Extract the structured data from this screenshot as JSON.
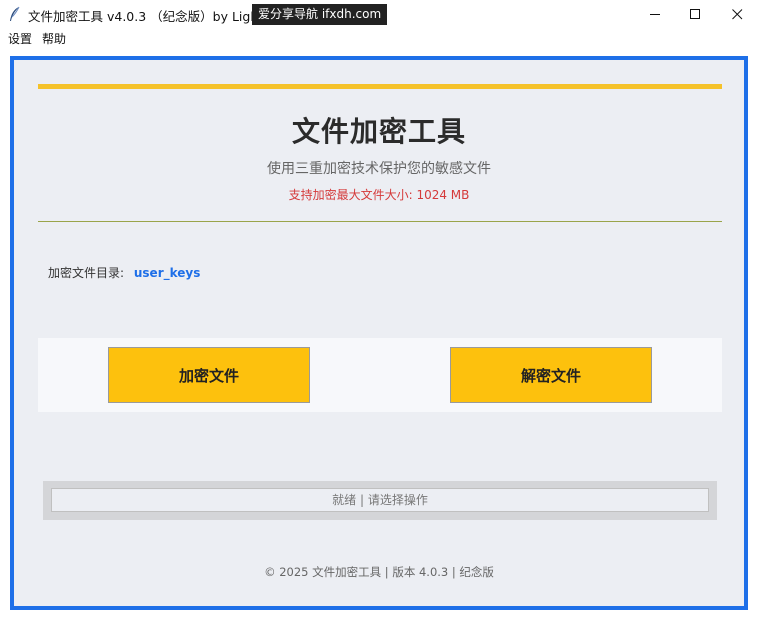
{
  "window": {
    "title": "文件加密工具  v4.0.3  （纪念版）by LightIO",
    "watermark": "爱分享导航 ifxdh.com",
    "icon": "feather-icon",
    "controls": [
      "minimize-icon",
      "maximize-icon",
      "close-icon"
    ]
  },
  "menu": {
    "settings": "设置",
    "help": "帮助"
  },
  "header": {
    "title": "文件加密工具",
    "subtitle": "使用三重加密技术保护您的敏感文件",
    "size_note": "支持加密最大文件大小: 1024 MB"
  },
  "directory": {
    "label": "加密文件目录:",
    "value": "user_keys"
  },
  "actions": {
    "encrypt": "加密文件",
    "decrypt": "解密文件"
  },
  "status": {
    "text": "就绪 | 请选择操作"
  },
  "footer": {
    "text": "© 2025 文件加密工具 | 版本 4.0.3 | 纪念版"
  },
  "colors": {
    "frame_border": "#1e6fe8",
    "accent": "#f5c22a",
    "button": "#fdc10d",
    "warning_text": "#d53a3a",
    "link_text": "#1e6fe8"
  }
}
